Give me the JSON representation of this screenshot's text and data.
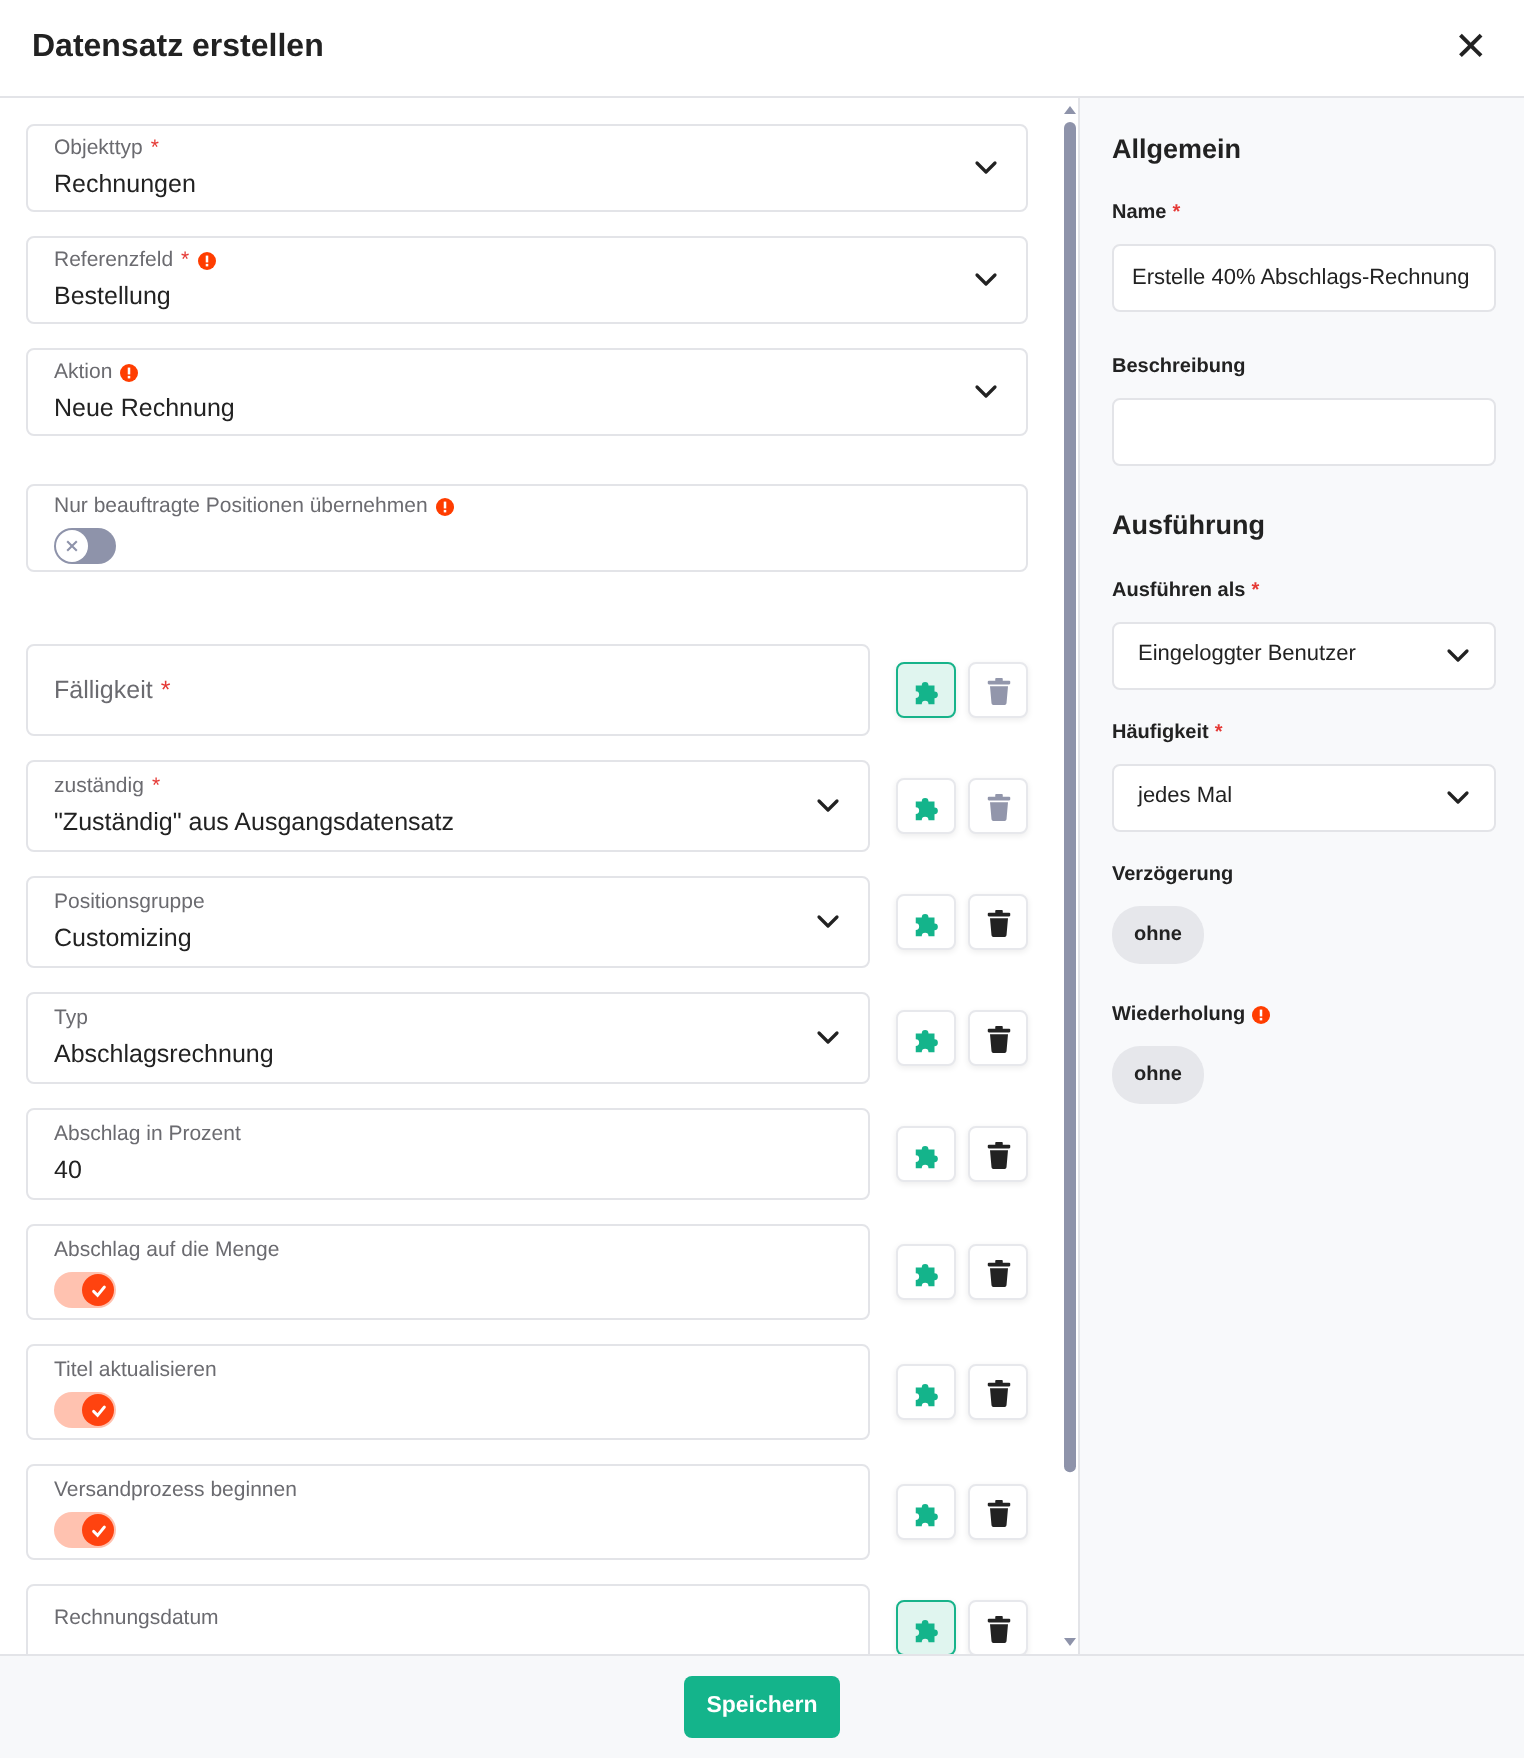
{
  "dialog": {
    "title": "Datensatz erstellen",
    "close_glyph": "✕"
  },
  "top_fields": [
    {
      "kind": "select",
      "label": "Objekttyp",
      "required_mark": "*",
      "info": false,
      "value": "Rechnungen"
    },
    {
      "kind": "select",
      "label": "Referenzfeld",
      "required_mark": "*",
      "info": true,
      "value": "Bestellung"
    },
    {
      "kind": "select",
      "label": "Aktion",
      "info": true,
      "value": "Neue Rechnung"
    },
    {
      "kind": "toggle",
      "label": "Nur beauftragte Positionen übernehmen",
      "info": true,
      "on": false
    }
  ],
  "field_rows": [
    {
      "kind": "empty",
      "label": "Fälligkeit",
      "required_mark": "*",
      "highlighted": true,
      "delete_disabled": true
    },
    {
      "kind": "select",
      "label": "zuständig",
      "required_mark": "*",
      "value": "\"Zuständig\" aus Ausgangsdatensatz",
      "highlighted": false,
      "delete_disabled": true
    },
    {
      "kind": "select",
      "label": "Positionsgruppe",
      "value": "Customizing",
      "highlighted": false,
      "delete_disabled": false
    },
    {
      "kind": "select",
      "label": "Typ",
      "value": "Abschlagsrechnung",
      "highlighted": false,
      "delete_disabled": false
    },
    {
      "kind": "text",
      "label": "Abschlag in Prozent",
      "value": "40",
      "highlighted": false,
      "delete_disabled": false
    },
    {
      "kind": "toggle",
      "label": "Abschlag auf die Menge",
      "on": true,
      "highlighted": false,
      "delete_disabled": false
    },
    {
      "kind": "toggle",
      "label": "Titel aktualisieren",
      "on": true,
      "highlighted": false,
      "delete_disabled": false
    },
    {
      "kind": "toggle",
      "label": "Versandprozess beginnen",
      "on": true,
      "highlighted": false,
      "delete_disabled": false
    },
    {
      "kind": "cut",
      "label": "Rechnungsdatum",
      "highlighted": true,
      "delete_disabled": false
    }
  ],
  "sidebar": [
    {
      "kind": "heading",
      "text": "Allgemein"
    },
    {
      "kind": "input",
      "label": "Name",
      "required_mark": "*",
      "value": "Erstelle 40% Abschlags-Rechnung"
    },
    {
      "kind": "input",
      "label": "Beschreibung"
    },
    {
      "kind": "heading",
      "text": "Ausführung"
    },
    {
      "kind": "select",
      "label": "Ausführen als",
      "required_mark": "*",
      "value": "Eingeloggter Benutzer"
    },
    {
      "kind": "select",
      "label": "Häufigkeit",
      "required_mark": "*",
      "value": "jedes Mal"
    },
    {
      "kind": "chip",
      "label": "Verzögerung",
      "value": "ohne"
    },
    {
      "kind": "chip",
      "label": "Wiederholung",
      "info": true,
      "value": "ohne"
    }
  ],
  "footer": {
    "save_label": "Speichern"
  }
}
